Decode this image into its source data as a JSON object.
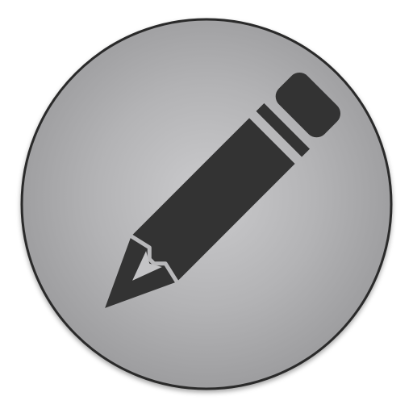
{
  "app_icon": {
    "name": "edit-icon",
    "glyph": "pencil-icon",
    "colors": {
      "background": "#ffffff",
      "badge_center": "#cbcbcd",
      "badge_edge": "#9a9a9c",
      "badge_outline": "#2a2a2a",
      "glyph": "#333333"
    }
  }
}
